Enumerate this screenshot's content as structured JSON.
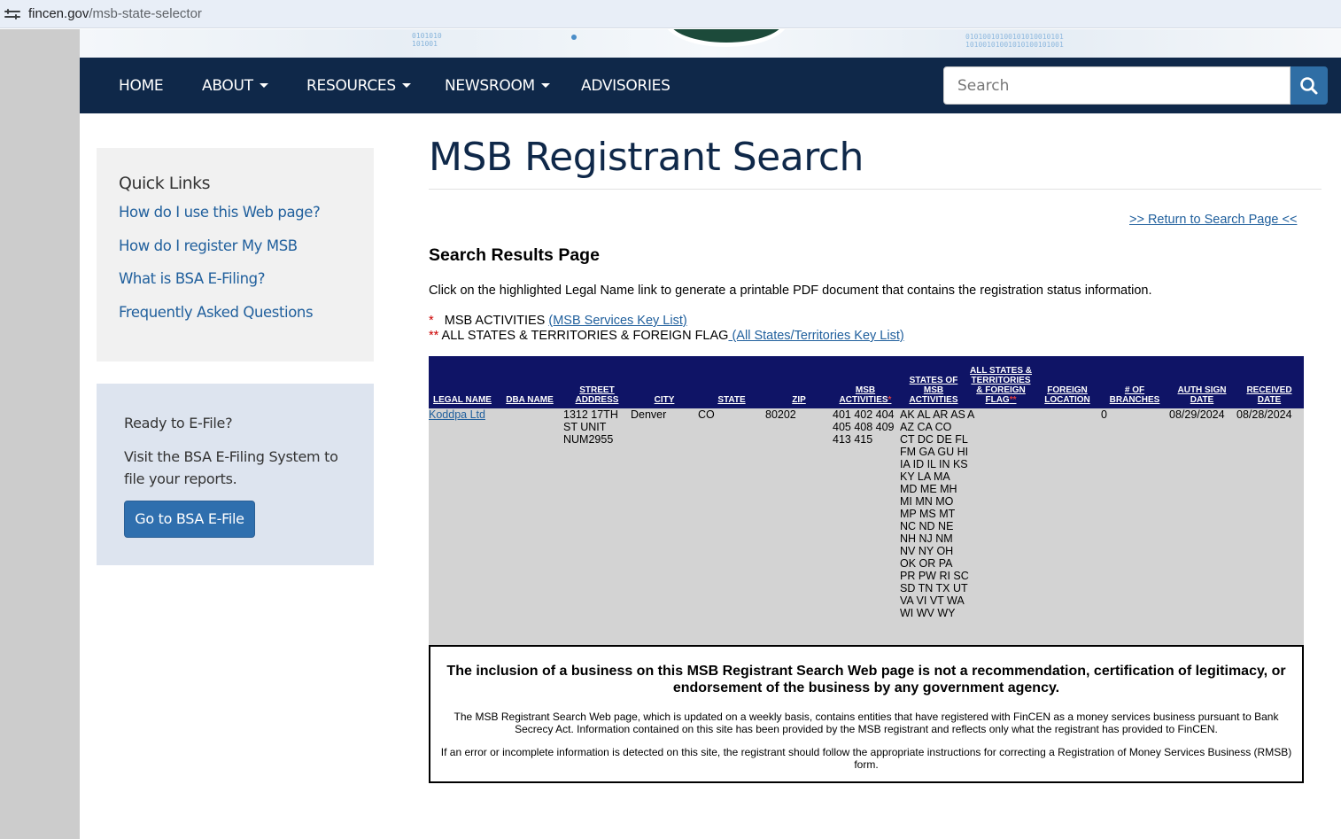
{
  "browser": {
    "url_host": "fincen.gov",
    "url_path": "/msb-state-selector"
  },
  "nav": {
    "items": [
      {
        "label": "HOME",
        "dropdown": false
      },
      {
        "label": "ABOUT",
        "dropdown": true
      },
      {
        "label": "RESOURCES",
        "dropdown": true
      },
      {
        "label": "NEWSROOM",
        "dropdown": true
      },
      {
        "label": "ADVISORIES",
        "dropdown": false
      }
    ],
    "search_placeholder": "Search"
  },
  "sidebar": {
    "quick_links_title": "Quick Links",
    "links": [
      "How do I use this Web page?",
      "How do I register My MSB",
      "What is BSA E-Filing?",
      "Frequently Asked Questions"
    ],
    "efile": {
      "title": "Ready to E-File?",
      "text": "Visit the BSA E-Filing System to file your reports.",
      "button": "Go to BSA E-File"
    }
  },
  "main": {
    "title": "MSB Registrant Search",
    "return_link": ">> Return to Search Page <<",
    "subheading": "Search Results Page",
    "instructions": "Click on the highlighted Legal Name link to generate a printable PDF document that contains the registration status information.",
    "key1": {
      "marker": "*",
      "label": "MSB ACTIVITIES",
      "link": "(MSB Services Key List)"
    },
    "key2": {
      "marker": "**",
      "label": "ALL STATES & TERRITORIES & FOREIGN FLAG",
      "link": " (All States/Territories Key List)"
    }
  },
  "table": {
    "headers": [
      {
        "label": "LEGAL NAME",
        "marker": ""
      },
      {
        "label": "DBA NAME",
        "marker": ""
      },
      {
        "label": "STREET ADDRESS",
        "marker": ""
      },
      {
        "label": "CITY",
        "marker": ""
      },
      {
        "label": "STATE",
        "marker": ""
      },
      {
        "label": "ZIP",
        "marker": ""
      },
      {
        "label": "MSB ACTIVITIES",
        "marker": "*"
      },
      {
        "label": "STATES OF MSB ACTIVITIES",
        "marker": ""
      },
      {
        "label": "ALL STATES & TERRITORIES & FOREIGN FLAG",
        "marker": "**"
      },
      {
        "label": "FOREIGN LOCATION",
        "marker": ""
      },
      {
        "label": "# OF BRANCHES",
        "marker": ""
      },
      {
        "label": "AUTH SIGN DATE",
        "marker": ""
      },
      {
        "label": "RECEIVED DATE",
        "marker": ""
      }
    ],
    "row": {
      "legal_name": "Koddpa Ltd",
      "dba_name": "",
      "street_address": "1312 17TH ST UNIT NUM2955",
      "city": "Denver",
      "state": "CO",
      "zip": "80202",
      "msb_activities": "401 402 404 405 408 409 413 415",
      "states": "AK AL AR AS AZ CA CO CT DC DE FL FM GA GU HI IA ID IL IN KS KY LA MA MD ME MH MI MN MO MP MS MT NC ND NE NH NJ NM NV NY OH OK OR PA PR PW RI SC SD TN TX UT VA VI VT WA WI WV WY",
      "all_states_flag": "A",
      "foreign_location": "",
      "branches": "0",
      "auth_sign_date": "08/29/2024",
      "received_date": "08/28/2024"
    }
  },
  "disclaimer": {
    "headline": "The inclusion of a business on this MSB Registrant Search Web page is not a recommendation, certification of legitimacy, or endorsement of the business by any government agency.",
    "p1": "The MSB Registrant Search Web page, which is updated on a weekly basis, contains entities that have registered with FinCEN as a money services business pursuant to Bank Secrecy Act. Information contained on this site has been provided by the MSB registrant and reflects only what the registrant has provided to FinCEN.",
    "p2": "If an error or incomplete information is detected on this site, the registrant should follow the appropriate instructions for correcting a Registration of Money Services Business (RMSB) form."
  }
}
